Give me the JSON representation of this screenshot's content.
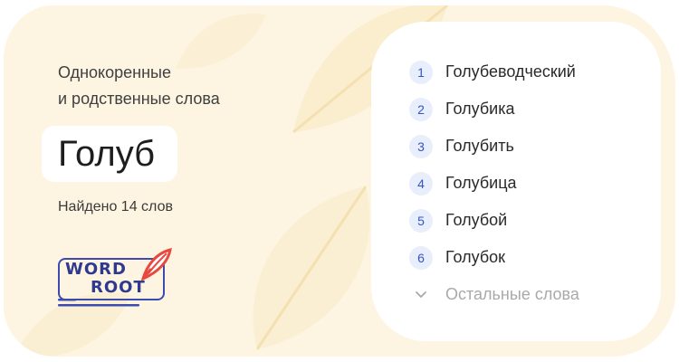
{
  "left": {
    "subtitle_line1": "Однокоренные",
    "subtitle_line2": "и родственные слова",
    "word": "Голуб",
    "found_text": "Найдено 14 слов"
  },
  "logo": {
    "line1": "WORD",
    "line2": "ROOT",
    "icon": "feather-icon"
  },
  "words": [
    {
      "num": "1",
      "label": "Голубеводческий"
    },
    {
      "num": "2",
      "label": "Голубика"
    },
    {
      "num": "3",
      "label": "Голубить"
    },
    {
      "num": "4",
      "label": "Голубица"
    },
    {
      "num": "5",
      "label": "Голубой"
    },
    {
      "num": "6",
      "label": "Голубок"
    }
  ],
  "more": {
    "label": "Остальные слова",
    "icon": "chevron-down-icon"
  },
  "colors": {
    "card_bg": "#fdf5e2",
    "badge_bg": "#e8eefb",
    "badge_text": "#3355c9",
    "logo_blue": "#2f3a8f",
    "feather_red": "#e8483e",
    "muted": "#a9a9a9"
  }
}
